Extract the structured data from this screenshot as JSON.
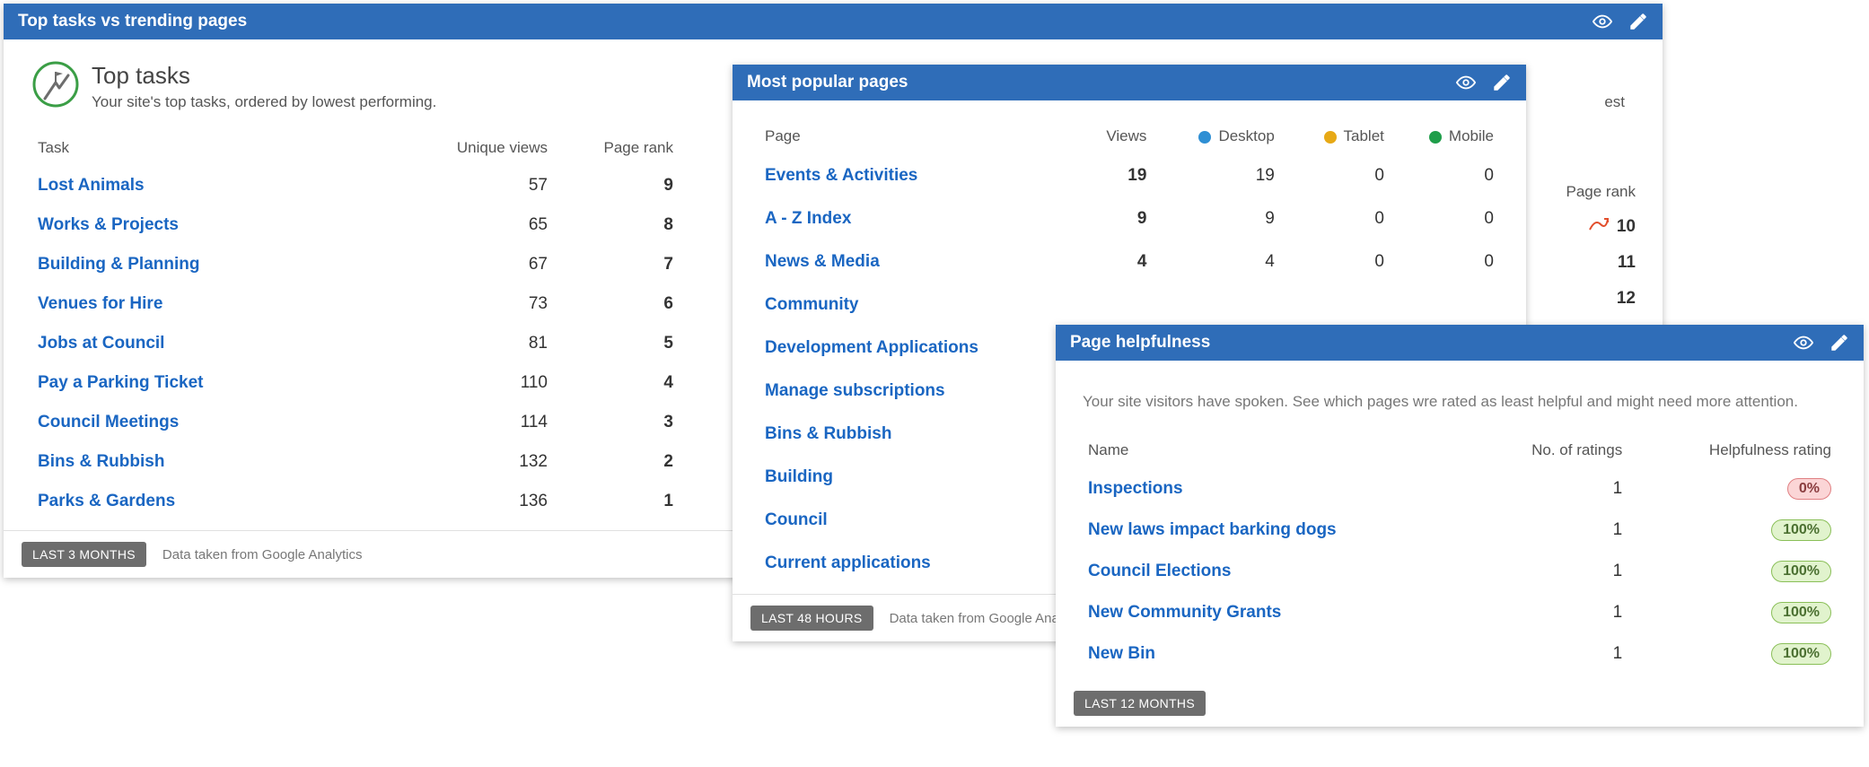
{
  "panel1": {
    "title": "Top tasks vs trending pages",
    "sub_heading": "Top tasks",
    "sub_desc": "Your site's top tasks, ordered by lowest performing.",
    "col_task": "Task",
    "col_views": "Unique views",
    "col_rank": "Page rank",
    "rows": [
      {
        "task": "Lost Animals",
        "views": "57",
        "rank": "9"
      },
      {
        "task": "Works & Projects",
        "views": "65",
        "rank": "8"
      },
      {
        "task": "Building & Planning",
        "views": "67",
        "rank": "7"
      },
      {
        "task": "Venues for Hire",
        "views": "73",
        "rank": "6"
      },
      {
        "task": "Jobs at Council",
        "views": "81",
        "rank": "5"
      },
      {
        "task": "Pay a Parking Ticket",
        "views": "110",
        "rank": "4"
      },
      {
        "task": "Council Meetings",
        "views": "114",
        "rank": "3"
      },
      {
        "task": "Bins & Rubbish",
        "views": "132",
        "rank": "2"
      },
      {
        "task": "Parks & Gardens",
        "views": "136",
        "rank": "1"
      }
    ],
    "right_rank_header": "Page rank",
    "right_ranks": [
      "10",
      "11",
      "12"
    ],
    "range": "LAST 3 MONTHS",
    "note": "Data taken from Google Analytics",
    "partial_text": "est"
  },
  "panel2": {
    "title": "Most popular pages",
    "col_page": "Page",
    "col_views": "Views",
    "legend_desktop": "Desktop",
    "legend_tablet": "Tablet",
    "legend_mobile": "Mobile",
    "rows": [
      {
        "page": "Events & Activities",
        "views": "19",
        "d": "19",
        "t": "0",
        "m": "0"
      },
      {
        "page": "A - Z Index",
        "views": "9",
        "d": "9",
        "t": "0",
        "m": "0"
      },
      {
        "page": "News & Media",
        "views": "4",
        "d": "4",
        "t": "0",
        "m": "0"
      },
      {
        "page": "Community",
        "views": "",
        "d": "",
        "t": "",
        "m": ""
      },
      {
        "page": "Development Applications",
        "views": "",
        "d": "",
        "t": "",
        "m": ""
      },
      {
        "page": "Manage subscriptions",
        "views": "",
        "d": "",
        "t": "",
        "m": ""
      },
      {
        "page": "Bins & Rubbish",
        "views": "",
        "d": "",
        "t": "",
        "m": ""
      },
      {
        "page": "Building",
        "views": "",
        "d": "",
        "t": "",
        "m": ""
      },
      {
        "page": "Council",
        "views": "",
        "d": "",
        "t": "",
        "m": ""
      },
      {
        "page": "Current applications",
        "views": "",
        "d": "",
        "t": "",
        "m": ""
      }
    ],
    "range": "LAST 48 HOURS",
    "note": "Data taken from Google Analy"
  },
  "panel3": {
    "title": "Page helpfulness",
    "desc": "Your site visitors have spoken. See which pages wre rated as least helpful and might need more attention.",
    "col_name": "Name",
    "col_ratings": "No. of ratings",
    "col_help": "Helpfulness rating",
    "rows": [
      {
        "name": "Inspections",
        "ratings": "1",
        "help": "0%",
        "cls": "help-red"
      },
      {
        "name": "New laws impact barking dogs",
        "ratings": "1",
        "help": "100%",
        "cls": "help-green"
      },
      {
        "name": "Council Elections",
        "ratings": "1",
        "help": "100%",
        "cls": "help-green"
      },
      {
        "name": "New Community Grants",
        "ratings": "1",
        "help": "100%",
        "cls": "help-green"
      },
      {
        "name": "New Bin",
        "ratings": "1",
        "help": "100%",
        "cls": "help-green"
      }
    ],
    "range": "LAST 12 MONTHS"
  },
  "colors": {
    "desktop": "#2f8fd4",
    "tablet": "#e7a916",
    "mobile": "#1f9e4a"
  }
}
